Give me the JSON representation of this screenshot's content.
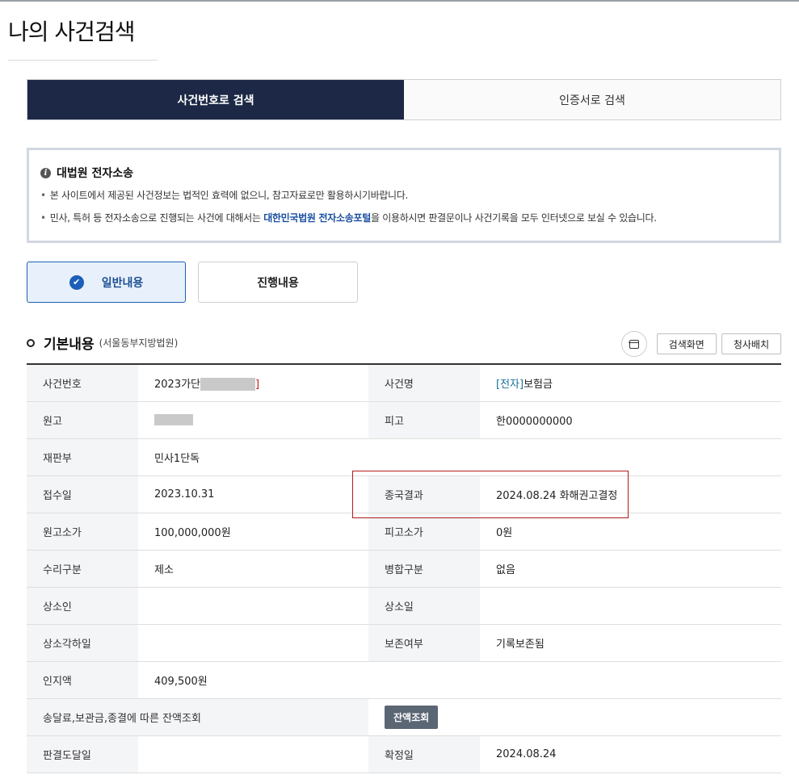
{
  "page": {
    "title": "나의 사건검색"
  },
  "search_tabs": [
    {
      "label": "사건번호로 검색",
      "active": true
    },
    {
      "label": "인증서로 검색",
      "active": false
    }
  ],
  "notice": {
    "title": "대법원 전자소송",
    "line1": "본 사이트에서 제공된 사건정보는 법적인 효력에 없으니, 참고자료로만 활용하시기바랍니다.",
    "line2_pre": "민사, 특허 등 전자소송으로 진행되는 사건에 대해서는 ",
    "line2_link": "대한민국법원 전자소송포털",
    "line2_post": "을 이용하시면 판결문이나 사건기록을 모두 인터넷으로 보실 수 있습니다."
  },
  "content_tabs": [
    {
      "label": "일반내용",
      "active": true
    },
    {
      "label": "진행내용",
      "active": false
    }
  ],
  "section": {
    "title": "기본내용",
    "court": "(서울동부지방법원)",
    "buttons": {
      "search_screen": "검색화면",
      "courthouse_map": "청사배치"
    }
  },
  "table": {
    "case_no_label": "사건번호",
    "case_no_prefix": "2023가단",
    "case_no_suffix": "]",
    "case_name_label": "사건명",
    "case_name_tag": "[전자]",
    "case_name_value": "보험금",
    "plaintiff_label": "원고",
    "defendant_label": "피고",
    "defendant_value": "한0000000000",
    "division_label": "재판부",
    "division_value": "민사1단독",
    "received_label": "접수일",
    "received_value": "2023.10.31",
    "result_label": "종국결과",
    "result_value": "2024.08.24 화해권고결정",
    "p_amount_label": "원고소가",
    "p_amount_value": "100,000,000원",
    "d_amount_label": "피고소가",
    "d_amount_value": "0원",
    "accept_label": "수리구분",
    "accept_value": "제소",
    "merge_label": "병합구분",
    "merge_value": "없음",
    "appellant_label": "상소인",
    "appeal_date_label": "상소일",
    "appeal_reject_label": "상소각하일",
    "preserve_label": "보존여부",
    "preserve_value": "기록보존됨",
    "stamp_label": "인지액",
    "stamp_value": "409,500원",
    "balance_label": "송달료,보관금,종결에 따른 잔액조회",
    "balance_button": "잔액조회",
    "delivery_label": "판결도달일",
    "final_label": "확정일",
    "final_value": "2024.08.24"
  }
}
